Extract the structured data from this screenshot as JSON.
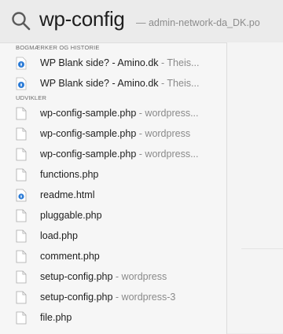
{
  "search": {
    "query": "wp-config",
    "hint": "— admin-network-da_DK.po"
  },
  "sections": {
    "bookmarks": {
      "title": "BOGMÆRKER OG HISTORIE",
      "items": [
        {
          "name": "WP Blank side? - Amino.dk",
          "sub": "- Theis..."
        },
        {
          "name": "WP Blank side? - Amino.dk",
          "sub": "- Theis..."
        }
      ]
    },
    "developer": {
      "title": "UDVIKLER",
      "items": [
        {
          "name": "wp-config-sample.php",
          "sub": "- wordpress..."
        },
        {
          "name": "wp-config-sample.php",
          "sub": "- wordpress"
        },
        {
          "name": "wp-config-sample.php",
          "sub": "- wordpress..."
        },
        {
          "name": "functions.php",
          "sub": ""
        },
        {
          "name": "readme.html",
          "sub": ""
        },
        {
          "name": "pluggable.php",
          "sub": ""
        },
        {
          "name": "load.php",
          "sub": ""
        },
        {
          "name": "comment.php",
          "sub": ""
        },
        {
          "name": "setup-config.php",
          "sub": "- wordpress"
        },
        {
          "name": "setup-config.php",
          "sub": "- wordpress-3"
        },
        {
          "name": "file.php",
          "sub": ""
        }
      ]
    }
  },
  "icons": {
    "search": "magnifier-icon",
    "bookmark": "safari-bookmark-icon",
    "html": "html-document-icon",
    "file": "text-document-icon"
  },
  "colors": {
    "accent": "#2b7bd6",
    "text": "#1e1e1e",
    "subtext": "#8a8a8a"
  }
}
